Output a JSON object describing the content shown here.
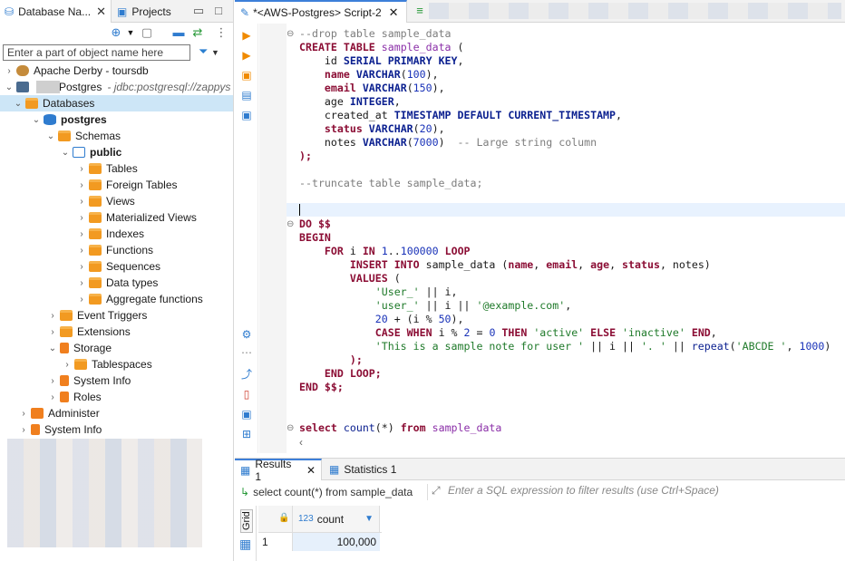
{
  "left_panel": {
    "tabs": [
      {
        "label": "Database Na..."
      },
      {
        "label": "Projects"
      }
    ],
    "search": {
      "placeholder": "Enter a part of object name here"
    },
    "tree": [
      {
        "label": "Apache Derby - toursdb"
      },
      {
        "label": "Postgres",
        "url": "- jdbc:postgresql://zappys"
      },
      {
        "label": "Databases"
      },
      {
        "label": "postgres"
      },
      {
        "label": "Schemas"
      },
      {
        "label": "public"
      },
      {
        "label": "Tables"
      },
      {
        "label": "Foreign Tables"
      },
      {
        "label": "Views"
      },
      {
        "label": "Materialized Views"
      },
      {
        "label": "Indexes"
      },
      {
        "label": "Functions"
      },
      {
        "label": "Sequences"
      },
      {
        "label": "Data types"
      },
      {
        "label": "Aggregate functions"
      },
      {
        "label": "Event Triggers"
      },
      {
        "label": "Extensions"
      },
      {
        "label": "Storage"
      },
      {
        "label": "Tablespaces"
      },
      {
        "label": "System Info"
      },
      {
        "label": "Roles"
      },
      {
        "label": "Administer"
      },
      {
        "label": "System Info"
      }
    ]
  },
  "editor": {
    "tab_title": "*<AWS-Postgres> Script-2",
    "code_lines": [
      "--drop table sample_data",
      "CREATE TABLE sample_data (",
      "    id SERIAL PRIMARY KEY,",
      "    name VARCHAR(100),",
      "    email VARCHAR(150),",
      "    age INTEGER,",
      "    created_at TIMESTAMP DEFAULT CURRENT_TIMESTAMP,",
      "    status VARCHAR(20),",
      "    notes VARCHAR(7000)  -- Large string column",
      ");",
      "",
      "--truncate table sample_data;",
      "",
      "",
      "DO $$",
      "BEGIN",
      "    FOR i IN 1..100000 LOOP",
      "        INSERT INTO sample_data (name, email, age, status, notes)",
      "        VALUES (",
      "            'User_' || i,",
      "            'user_' || i || '@example.com',",
      "            20 + (i % 50),",
      "            CASE WHEN i % 2 = 0 THEN 'active' ELSE 'inactive' END,",
      "            'This is a sample note for user ' || i || '. ' || repeat('ABCDE ', 1000)",
      "        );",
      "    END LOOP;",
      "END $$;",
      "",
      "",
      "select count(*) from sample_data"
    ]
  },
  "results": {
    "tabs": [
      {
        "label": "Results 1"
      },
      {
        "label": "Statistics 1"
      }
    ],
    "query_text": "select count(*) from sample_data",
    "filter_placeholder": "Enter a SQL expression to filter results (use Ctrl+Space)",
    "grid_label": "Grid",
    "column": {
      "type_prefix": "123",
      "name": "count"
    },
    "rows": [
      {
        "index": "1",
        "count": "100,000"
      }
    ]
  },
  "colors": {
    "selection": "#cde6f7",
    "accent": "#3d7fd9",
    "keyword": "#8b0d34",
    "string": "#1f7a2a",
    "comment": "#7d7d7d",
    "number": "#1932b8"
  }
}
